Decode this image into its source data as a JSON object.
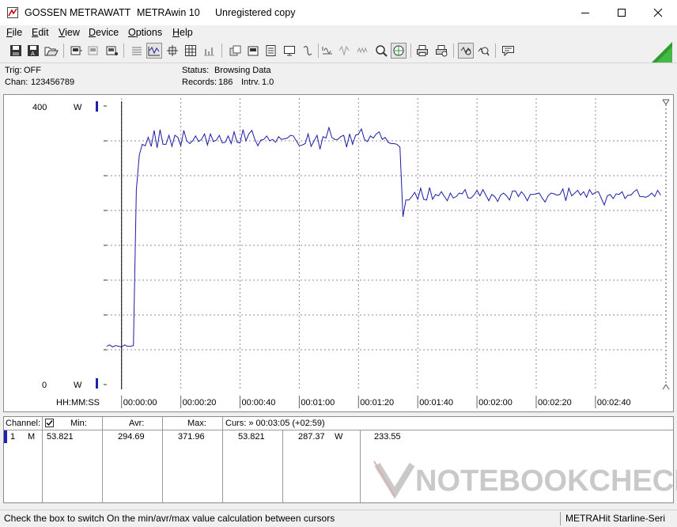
{
  "window": {
    "app_name": "GOSSEN METRAWATT",
    "product": "METRAwin 10",
    "license": "Unregistered copy"
  },
  "menu": [
    {
      "label": "File",
      "key": "F",
      "rest": "ile"
    },
    {
      "label": "Edit",
      "key": "E",
      "rest": "dit"
    },
    {
      "label": "View",
      "key": "V",
      "rest": "iew"
    },
    {
      "label": "Device",
      "key": "D",
      "rest": "evice"
    },
    {
      "label": "Options",
      "key": "O",
      "rest": "ptions"
    },
    {
      "label": "Help",
      "key": "H",
      "rest": "elp"
    }
  ],
  "info": {
    "trig_label": "Trig:",
    "trig_value": "OFF",
    "chan_label": "Chan:",
    "chan_value": "123456789",
    "status_label": "Status:",
    "status_value": "Browsing Data",
    "records_label": "Records:",
    "records_value": "186",
    "intrv_label": "Intrv.",
    "intrv_value": "1.0"
  },
  "chart_data": {
    "type": "line",
    "ylim": [
      0,
      400
    ],
    "y_top_label": "400",
    "y_bottom_label": "0",
    "y_unit": "W",
    "x_axis_label": "HH:MM:SS",
    "x_tick_labels": [
      "00:00:00",
      "00:00:20",
      "00:00:40",
      "00:01:00",
      "00:01:20",
      "00:01:40",
      "00:02:00",
      "00:02:20",
      "00:02:40"
    ],
    "x_range_seconds": [
      -5,
      183
    ],
    "cursor_x_seconds": 0,
    "series": [
      {
        "color": "#1c1ca8",
        "x_start": -5,
        "x_step": 1,
        "values": [
          55,
          57,
          54,
          56,
          55,
          54,
          57,
          55,
          55,
          56,
          280,
          330,
          345,
          343,
          355,
          342,
          365,
          340,
          366,
          345,
          345,
          358,
          342,
          358,
          355,
          343,
          365,
          350,
          346,
          350,
          357,
          349,
          352,
          360,
          344,
          360,
          349,
          351,
          358,
          347,
          348,
          357,
          346,
          363,
          348,
          347,
          366,
          350,
          360,
          365,
          352,
          343,
          351,
          352,
          357,
          350,
          352,
          348,
          356,
          352,
          353,
          354,
          358,
          357,
          350,
          343,
          344,
          346,
          360,
          342,
          350,
          358,
          338,
          356,
          354,
          369,
          355,
          352,
          352,
          356,
          358,
          341,
          360,
          345,
          358,
          360,
          367,
          352,
          349,
          357,
          354,
          360,
          363,
          352,
          355,
          348,
          346,
          346,
          345,
          341,
          241,
          265,
          265,
          270,
          276,
          266,
          282,
          266,
          265,
          283,
          266,
          273,
          271,
          277,
          270,
          264,
          275,
          268,
          270,
          275,
          274,
          280,
          268,
          268,
          272,
          279,
          271,
          280,
          272,
          264,
          273,
          270,
          263,
          272,
          275,
          271,
          265,
          278,
          278,
          270,
          277,
          272,
          264,
          273,
          273,
          274,
          275,
          268,
          262,
          271,
          275,
          274,
          272,
          273,
          281,
          264,
          282,
          271,
          275,
          279,
          272,
          277,
          269,
          280,
          273,
          276,
          277,
          267,
          258,
          271,
          273,
          267,
          274,
          273,
          277,
          267,
          272,
          272,
          277,
          280,
          270,
          270,
          269,
          271,
          275,
          270,
          279,
          272
        ]
      }
    ]
  },
  "stats": {
    "channel_header": "Channel:",
    "min_header": "Min:",
    "avr_header": "Avr:",
    "max_header": "Max:",
    "cursor_header": "Curs: » 00:03:05 (+02:59)",
    "row_channel": "1",
    "row_mode": "M",
    "min": "53.821",
    "avr": "294.69",
    "max": "371.96",
    "cursor_value": "53.821",
    "cursor_avg": "287.37",
    "cursor_unit": "W",
    "cursor_extra": "233.55"
  },
  "watermark": "NOTEBOOKCHECK",
  "status": {
    "hint": "Check the box to switch On the min/avr/max value calculation between cursors",
    "device": "METRAHit Starline-Seri"
  },
  "colors": {
    "trace": "#1c1ca8",
    "grid": "#8c8c8c",
    "marker": "#2020b0",
    "accent_triangle": "#2d9c2d"
  },
  "icons": [
    "save-icon",
    "save-as-icon",
    "open-icon",
    "device-read-icon",
    "device-write-icon",
    "device-settings-icon",
    "list-view-icon",
    "graph-view-icon",
    "cursor-view-icon",
    "table-view-icon",
    "bar-view-icon",
    "export-icon",
    "print-setup-icon",
    "report-icon",
    "monitor-icon",
    "transfer-icon",
    "wave1-icon",
    "wave2-icon",
    "wave3-icon",
    "zoom-icon",
    "zoom-fit-icon",
    "print-icon",
    "print-preview-icon",
    "auto-scale-icon",
    "zoom-out-icon",
    "message-icon"
  ]
}
